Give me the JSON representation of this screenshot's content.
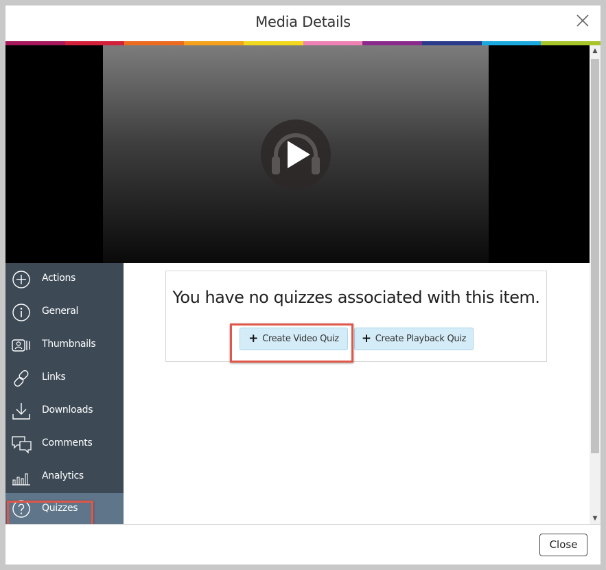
{
  "dialog": {
    "title": "Media Details",
    "rainbow_colors": [
      "#a6195b",
      "#d3203b",
      "#ec6b21",
      "#f6a11c",
      "#f2d81d",
      "#ee82b4",
      "#8a2b8c",
      "#2c3a8c",
      "#1ca9df",
      "#a7c52b"
    ]
  },
  "player": {
    "play_icon": "headphones-play-icon"
  },
  "sidebar": {
    "items": [
      {
        "label": "Actions",
        "icon": "plus-circle-icon"
      },
      {
        "label": "General",
        "icon": "info-circle-icon"
      },
      {
        "label": "Thumbnails",
        "icon": "thumbnails-icon"
      },
      {
        "label": "Links",
        "icon": "link-icon"
      },
      {
        "label": "Downloads",
        "icon": "download-icon"
      },
      {
        "label": "Comments",
        "icon": "comments-icon"
      },
      {
        "label": "Analytics",
        "icon": "analytics-icon"
      },
      {
        "label": "Quizzes",
        "icon": "question-circle-icon"
      }
    ],
    "active": "Quizzes"
  },
  "quizzes": {
    "message": "You have no quizzes associated with this item.",
    "create_video_quiz": "Create Video Quiz",
    "create_playback_quiz": "Create Playback Quiz"
  },
  "footer": {
    "close_label": "Close"
  },
  "colors": {
    "sidebar_bg": "#3d4a56",
    "sidebar_active": "#5f7589",
    "highlight": "#e0574a",
    "button_bg": "#d4ecf7"
  }
}
